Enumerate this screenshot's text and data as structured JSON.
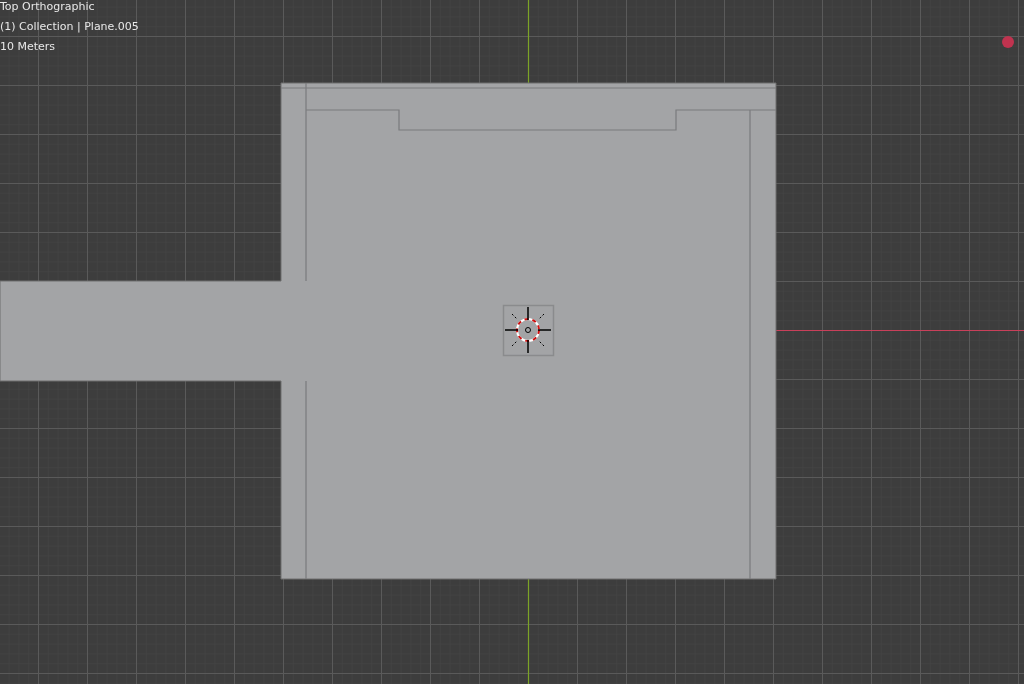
{
  "viewport": {
    "view_name": "Top Orthographic",
    "object_info": "(1) Collection | Plane.005",
    "scale": "10 Meters"
  }
}
